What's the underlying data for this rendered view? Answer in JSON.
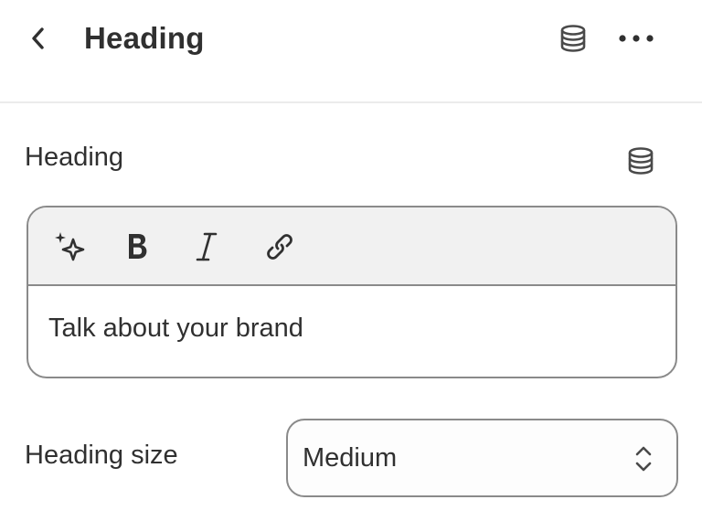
{
  "header": {
    "title": "Heading",
    "back_icon": "chevron-left-icon",
    "source_icon": "database-icon",
    "more_icon": "more-horizontal-icon"
  },
  "heading_field": {
    "label": "Heading",
    "source_icon": "database-icon",
    "toolbar": [
      {
        "name": "ai-sparkle",
        "icon": "sparkle-icon"
      },
      {
        "name": "bold",
        "icon": "bold-icon"
      },
      {
        "name": "italic",
        "icon": "italic-icon"
      },
      {
        "name": "link",
        "icon": "link-icon"
      }
    ],
    "value": "Talk about your brand"
  },
  "heading_size": {
    "label": "Heading size",
    "selected": "Medium",
    "icon": "select-chevron-icon"
  },
  "colors": {
    "text": "#303030",
    "border": "#8a8a8a",
    "toolbar_bg": "#f1f1f1",
    "divider": "#ebebeb"
  }
}
